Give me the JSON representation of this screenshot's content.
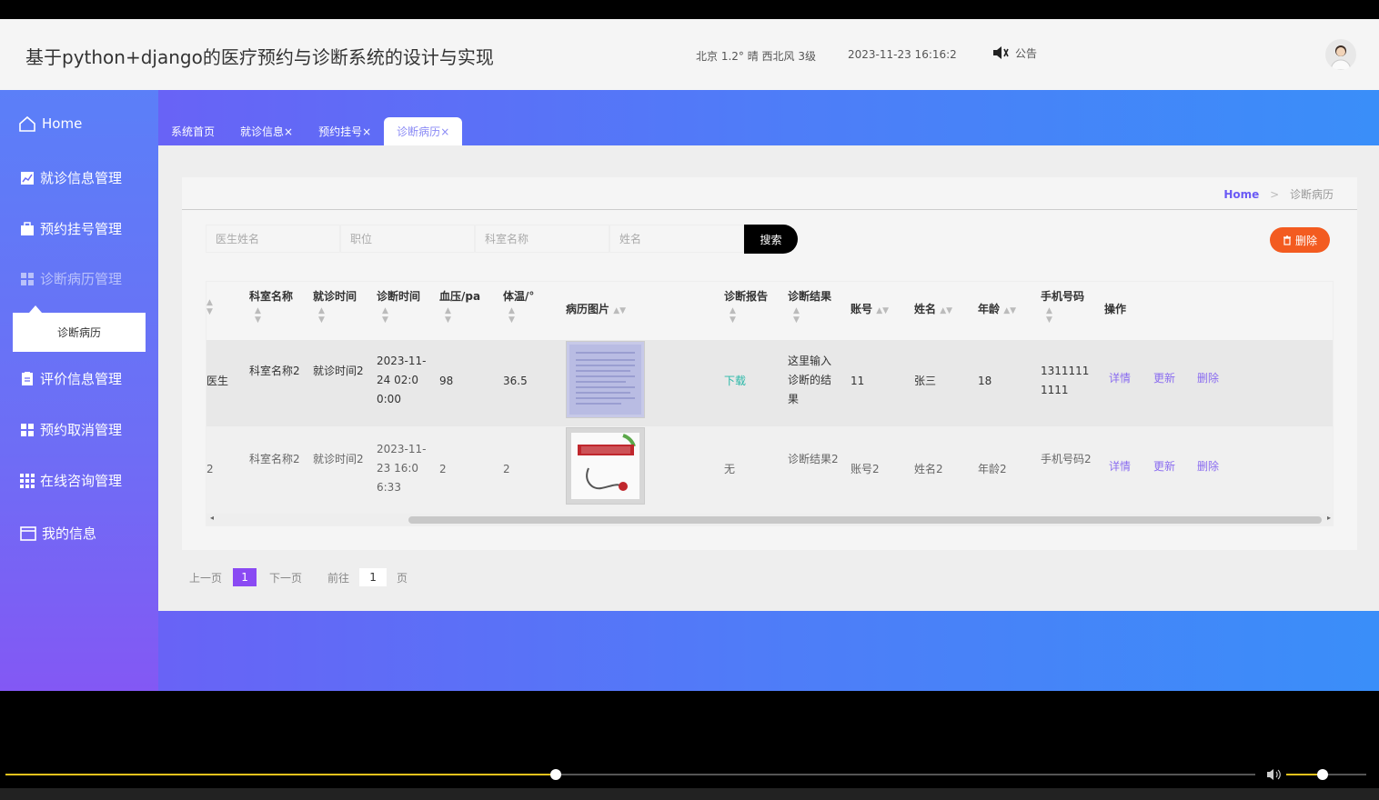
{
  "header": {
    "title": "基于python+django的医疗预约与诊断系统的设计与实现",
    "weather": "北京  1.2°  晴  西北风  3级",
    "datetime": "2023-11-23 16:16:2",
    "notice": "公告"
  },
  "sidebar": {
    "items": [
      {
        "label": "Home",
        "icon": "home-icon"
      },
      {
        "label": "就诊信息管理",
        "icon": "chart-icon"
      },
      {
        "label": "预约挂号管理",
        "icon": "briefcase-icon"
      },
      {
        "label": "诊断病历管理",
        "icon": "grid-icon"
      },
      {
        "label": "评价信息管理",
        "icon": "document-icon"
      },
      {
        "label": "预约取消管理",
        "icon": "grid-icon"
      },
      {
        "label": "在线咨询管理",
        "icon": "grid9-icon"
      },
      {
        "label": "我的信息",
        "icon": "card-icon"
      }
    ],
    "submenu": "诊断病历"
  },
  "tabs": [
    {
      "label": "系统首页",
      "close": ""
    },
    {
      "label": "就诊信息",
      "close": "×"
    },
    {
      "label": "预约挂号",
      "close": "×"
    },
    {
      "label": "诊断病历",
      "close": "×"
    }
  ],
  "breadcrumb": {
    "home": "Home",
    "separator": ">",
    "current": "诊断病历"
  },
  "search": {
    "doctor_placeholder": "医生姓名",
    "title_placeholder": "职位",
    "dept_placeholder": "科室名称",
    "name_placeholder": "姓名",
    "button": "搜索"
  },
  "delete_button": "删除",
  "table": {
    "headers": [
      "科室名称",
      "就诊时间",
      "诊断时间",
      "血压/pa",
      "体温/°",
      "病历图片",
      "诊断报告",
      "诊断结果",
      "账号",
      "姓名",
      "年龄",
      "手机号码",
      "操作"
    ],
    "rows": [
      {
        "doctor": "医生",
        "dept": "科室名称2",
        "visit": "就诊时间2",
        "diag_time": "2023-11-24 02:00:00",
        "bp": "98",
        "temp": "36.5",
        "report": "下载",
        "result": "这里输入诊断的结果",
        "account": "11",
        "name": "张三",
        "age": "18",
        "phone": "13111111111"
      },
      {
        "doctor": "2",
        "dept": "科室名称2",
        "visit": "就诊时间2",
        "diag_time": "2023-11-23 16:06:33",
        "bp": "2",
        "temp": "2",
        "report": "无",
        "result": "诊断结果2",
        "account": "账号2",
        "name": "姓名2",
        "age": "年龄2",
        "phone": "手机号码2"
      }
    ],
    "actions": {
      "detail": "详情",
      "update": "更新",
      "delete": "删除"
    }
  },
  "pager": {
    "prev": "上一页",
    "current": "1",
    "next": "下一页",
    "goto": "前往",
    "goto_value": "1",
    "page_unit": "页"
  },
  "player": {
    "progress": 0.44,
    "volume": 0.45
  }
}
